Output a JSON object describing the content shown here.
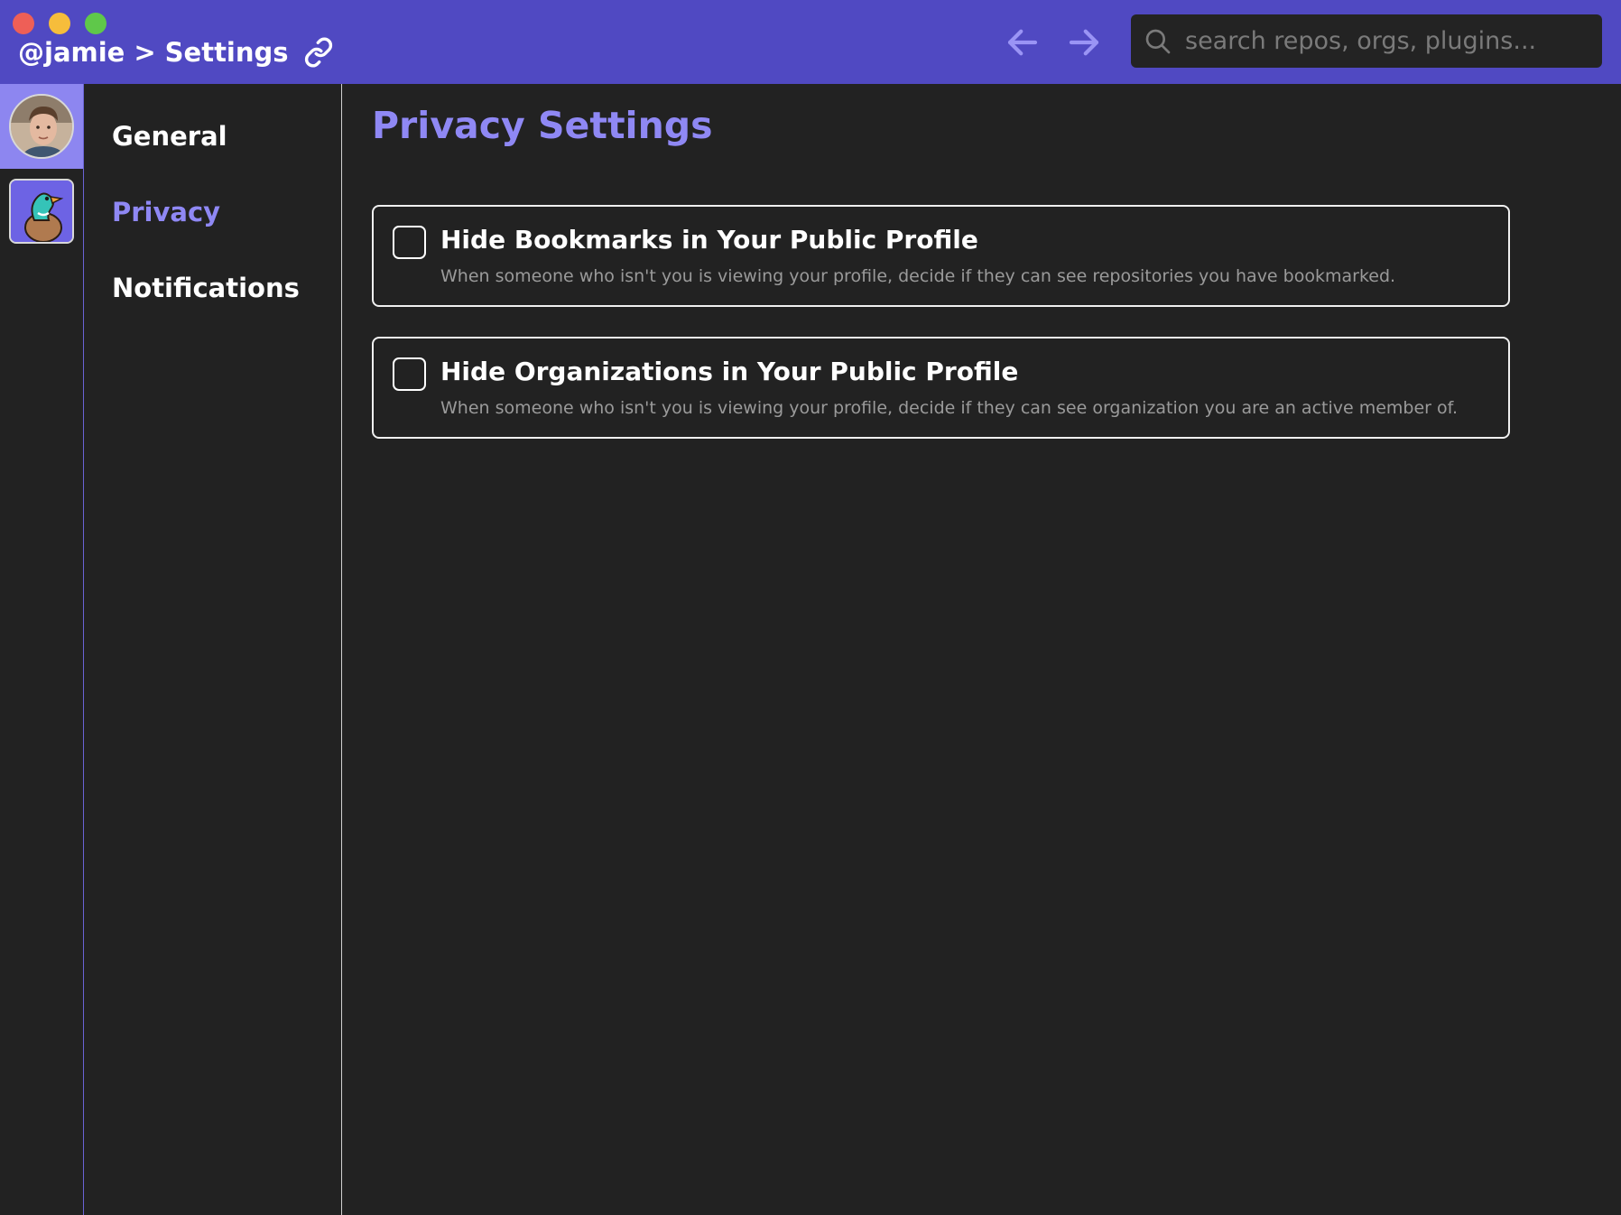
{
  "window": {
    "breadcrumb": {
      "user": "@jamie",
      "separator": ">",
      "page": "Settings"
    },
    "search": {
      "placeholder": "search repos, orgs, plugins..."
    }
  },
  "colors": {
    "titlebar": "#5049c2",
    "accent": "#8f88f4",
    "background": "#222222"
  },
  "rail": {
    "items": [
      {
        "icon": "user-avatar",
        "active": true
      },
      {
        "icon": "duck-org-avatar",
        "active": false
      }
    ]
  },
  "settings_nav": {
    "items": [
      {
        "label": "General",
        "active": false
      },
      {
        "label": "Privacy",
        "active": true
      },
      {
        "label": "Notifications",
        "active": false
      }
    ]
  },
  "main": {
    "title": "Privacy Settings",
    "settings": [
      {
        "title": "Hide Bookmarks in Your Public Profile",
        "description": "When someone who isn't you is viewing your profile, decide if they can see repositories you have bookmarked.",
        "checked": false
      },
      {
        "title": "Hide Organizations in Your Public Profile",
        "description": "When someone who isn't you is viewing your profile, decide if they can see organization you are an active member of.",
        "checked": false
      }
    ]
  }
}
